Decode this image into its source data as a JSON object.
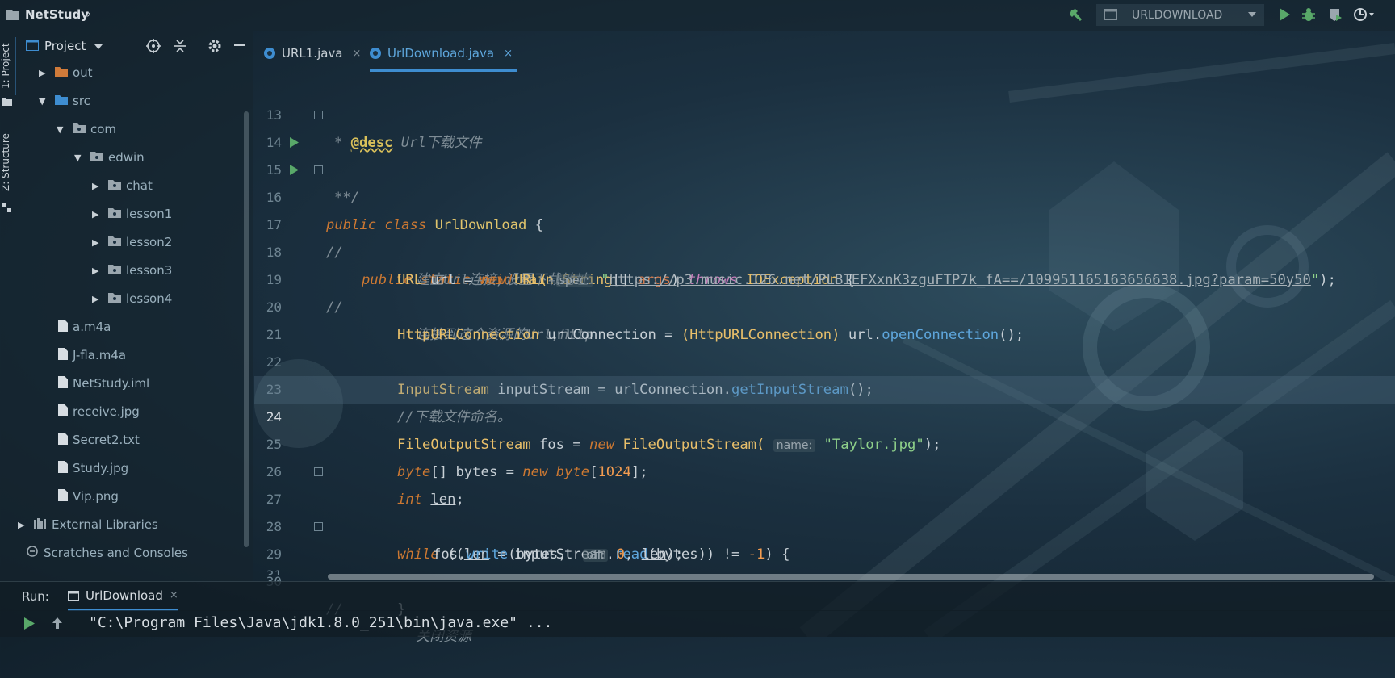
{
  "project": {
    "name": "NetStudy"
  },
  "toolbar": {
    "run_config": "URLDOWNLOAD"
  },
  "side_tabs": {
    "project": "1: Project",
    "structure": "Z: Structure"
  },
  "project_panel": {
    "title": "Project",
    "tree": [
      {
        "label": "out",
        "kind": "folder-orange",
        "arrow": "▶"
      },
      {
        "label": "src",
        "kind": "folder-blue",
        "arrow": "▼"
      },
      {
        "label": "com",
        "kind": "package",
        "arrow": "▼"
      },
      {
        "label": "edwin",
        "kind": "package",
        "arrow": "▼"
      },
      {
        "label": "chat",
        "kind": "package",
        "arrow": "▶"
      },
      {
        "label": "lesson1",
        "kind": "package",
        "arrow": "▶"
      },
      {
        "label": "lesson2",
        "kind": "package",
        "arrow": "▶"
      },
      {
        "label": "lesson3",
        "kind": "package",
        "arrow": "▶"
      },
      {
        "label": "lesson4",
        "kind": "package",
        "arrow": "▶"
      },
      {
        "label": "a.m4a",
        "kind": "file",
        "arrow": ""
      },
      {
        "label": "J-fla.m4a",
        "kind": "file",
        "arrow": ""
      },
      {
        "label": "NetStudy.iml",
        "kind": "file",
        "arrow": ""
      },
      {
        "label": "receive.jpg",
        "kind": "file",
        "arrow": ""
      },
      {
        "label": "Secret2.txt",
        "kind": "file",
        "arrow": ""
      },
      {
        "label": "Study.jpg",
        "kind": "file",
        "arrow": ""
      },
      {
        "label": "Vip.png",
        "kind": "file",
        "arrow": ""
      },
      {
        "label": "External Libraries",
        "kind": "library",
        "arrow": "▶"
      },
      {
        "label": "Scratches and Consoles",
        "kind": "scratch",
        "arrow": ""
      }
    ]
  },
  "tabs": [
    {
      "label": "URL1.java",
      "active": false
    },
    {
      "label": "UrlDownload.java",
      "active": true
    }
  ],
  "tab_close": "×",
  "code": {
    "line_numbers": [
      "13",
      "14",
      "15",
      "16",
      "17",
      "18",
      "19",
      "20",
      "21",
      "22",
      "23",
      "24",
      "25",
      "26",
      "27",
      "28",
      "29",
      "30",
      "31"
    ],
    "l13": {
      "star": "* ",
      "tag": "@desc",
      "rest": " Url下载文件"
    },
    "l14": {
      "text": "**/"
    },
    "l15": {
      "kw1": "public",
      "kw2": "class",
      "name": "UrlDownload",
      "brace": "{"
    },
    "l16": {
      "kw1": "public",
      "kw2": "static",
      "kw3": "void",
      "name": "main",
      "type": "String",
      "arr": "[] ",
      "param": "args",
      "kw4": "throws",
      "exc": "IOException",
      "brace": "{"
    },
    "l17": {
      "slashes": "//",
      "comment": "建立Url连接,设置下载地址."
    },
    "l18": {
      "type": "URL",
      "var": "url",
      "eq": "=",
      "kw": "new",
      "ctor": "URL(",
      "hint": "spec:",
      "q1": "\"",
      "url": "https://p3.music.126.net/PLBIEFXxnK3zguFTP7k_fA==/109951165163656638.jpg?param=50y50",
      "q2": "\"",
      "end": ");"
    },
    "l19": {
      "slashes": "//",
      "comment": "连接到这个资源的Url,http"
    },
    "l20": {
      "type": "HttpURLConnection",
      "var": "urlConnection",
      "eq": "=",
      "cast": "(HttpURLConnection)",
      "obj": "url.",
      "method": "openConnection",
      "end": "();"
    },
    "l22": {
      "type": "InputStream",
      "var": "inputStream",
      "eq": "=",
      "obj": "urlConnection.",
      "method": "getInputStream",
      "end": "();"
    },
    "l23": {
      "comment": "//下载文件命名。"
    },
    "l24": {
      "type": "FileOutputStream",
      "var": "fos",
      "eq": "=",
      "kw": "new",
      "ctor": "FileOutputStream(",
      "hint": "name:",
      "str": "\"Taylor.jpg\"",
      "end": ");"
    },
    "l25": {
      "kw": "byte",
      "arr": "[] ",
      "var": "bytes",
      "eq": "=",
      "kw2": "new",
      "kw3": "byte",
      "br1": "[",
      "num": "1024",
      "br2": "];"
    },
    "l26": {
      "kw": "int",
      "var": "len",
      "end": ";"
    },
    "l27": {
      "kw": "while",
      "p1": "((",
      "var": "len",
      "eq": " = inputStream.",
      "method": "read",
      "args": "(bytes)) != ",
      "num": "-1",
      "end": ") {"
    },
    "l28": {
      "obj": "fos.",
      "method": "write",
      "args": "(bytes, ",
      "hint": "off:",
      "num": "0",
      "sep": ", ",
      "var": "len",
      "end": ");"
    },
    "l29": {
      "text": "}"
    },
    "l30": {
      "slashes": "//",
      "comment": "关闭资源"
    }
  },
  "run": {
    "label": "Run:",
    "tab": "UrlDownload",
    "command": "\"C:\\Program Files\\Java\\jdk1.8.0_251\\bin\\java.exe\" ..."
  },
  "colors": {
    "accent": "#3e8dd0",
    "keyword": "#cc7832",
    "string": "#8fd18a",
    "method": "#5ea6dc",
    "type": "#e8bf6a"
  }
}
